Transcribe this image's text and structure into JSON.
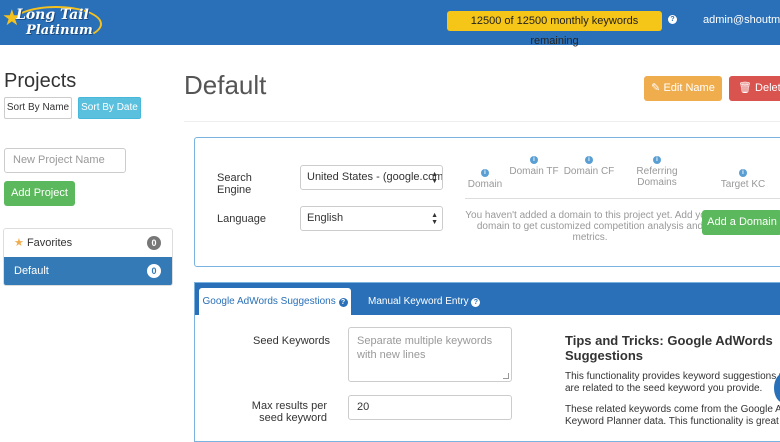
{
  "topbar": {
    "logo_line1": "Long Tail",
    "logo_line2": "Platinum",
    "keyword_quota": "12500 of 12500 monthly keywords remaining",
    "help_glyph": "?",
    "user_email": "admin@shoutmelo"
  },
  "sidebar": {
    "title": "Projects",
    "sort_by_name": "Sort By Name",
    "sort_by_date": "Sort By Date",
    "new_project_placeholder": "New Project Name",
    "add_project": "Add Project",
    "projects": [
      {
        "label": "Favorites",
        "count": "0",
        "icon": "star-icon"
      },
      {
        "label": "Default",
        "count": "0",
        "active": true
      }
    ]
  },
  "main": {
    "title": "Default",
    "edit_name": "Edit Name",
    "delete": "Delete"
  },
  "settings": {
    "search_engine_label": "Search Engine",
    "search_engine_value": "United States - (google.com",
    "language_label": "Language",
    "language_value": "English",
    "metrics": [
      "Domain",
      "Domain TF",
      "Domain CF",
      "Referring Domains",
      "Target KC"
    ],
    "empty_message": "You haven't added a domain to this project yet. Add your domain to get customized competition analysis and metrics.",
    "add_domain": "Add a Domain"
  },
  "keywords": {
    "tabs": [
      "Google AdWords Suggestions",
      "Manual Keyword Entry"
    ],
    "seed_label": "Seed Keywords",
    "seed_placeholder": "Separate multiple keywords with new lines",
    "max_results_label": "Max results per seed keyword",
    "max_results_value": "20",
    "tips_title": "Tips and Tricks: Google AdWords Suggestions",
    "tips_para1": "This functionality provides keyword suggestions whi are related to the seed keyword you provide.",
    "tips_para2": "These related keywords come from the Google AdW Keyword Planner data. This functionality is great for"
  },
  "colors": {
    "brand_blue": "#2a70b8",
    "quota_yellow": "#f5c518",
    "success_green": "#5cb85c",
    "warning_orange": "#f0ad4e",
    "danger_red": "#d9534f",
    "info_cyan": "#5bc0de"
  }
}
